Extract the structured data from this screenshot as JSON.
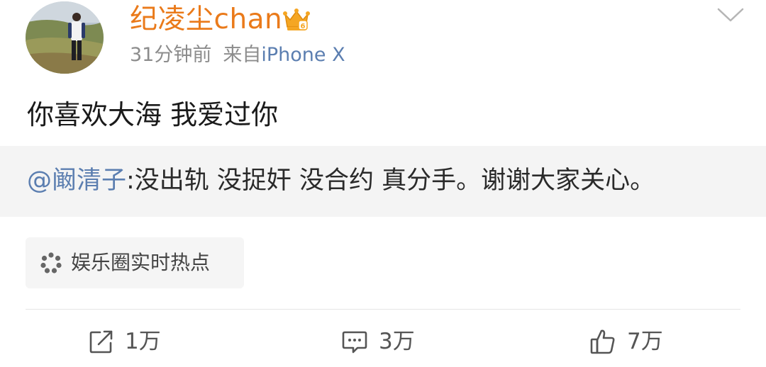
{
  "author": {
    "name": "纪凌尘chan",
    "time": "31分钟前",
    "source_prefix": "来自",
    "source_device": "iPhone X"
  },
  "post": {
    "text": "你喜欢大海 我爱过你"
  },
  "repost": {
    "mention": "@阚清子",
    "text": ":没出轨 没捉奸 没合约 真分手。谢谢大家关心。"
  },
  "topic": {
    "label": "娱乐圈实时热点"
  },
  "actions": {
    "repost_count": "1万",
    "comment_count": "3万",
    "like_count": "7万"
  },
  "icons": {
    "avatar": "user-avatar-photo",
    "vip": "crown-icon",
    "menu": "chevron-down-icon",
    "topic": "dots-burst-icon",
    "repost": "share-edit-icon",
    "comment": "comment-icon",
    "like": "thumbs-up-icon"
  },
  "colors": {
    "username": "#ea7a1a",
    "link": "#5b7eb0",
    "repost_bg": "#f4f4f4",
    "meta": "#8c8c8c"
  }
}
